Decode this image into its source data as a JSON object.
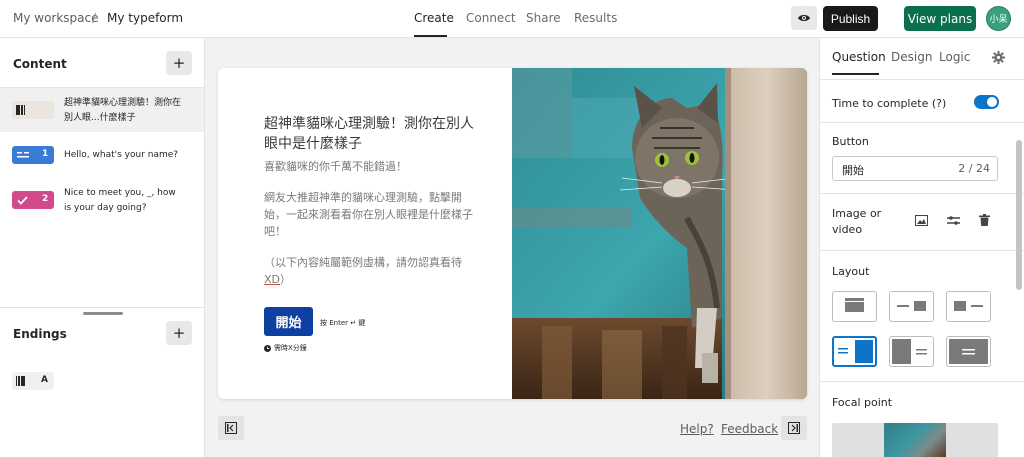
{
  "header": {
    "workspace": "My workspace",
    "separator": "/",
    "form_name": "My typeform",
    "tabs": [
      {
        "label": "Create"
      },
      {
        "label": "Connect"
      },
      {
        "label": "Share"
      },
      {
        "label": "Results"
      }
    ],
    "publish_label": "Publish",
    "plans_label": "View plans",
    "avatar_text": "小呆"
  },
  "left_panel": {
    "content_title": "Content",
    "items": [
      {
        "badge": "",
        "text": "超神準貓咪心理測驗！測你在別人眼...什麼樣子"
      },
      {
        "badge": "1",
        "text": "Hello, what's your name?"
      },
      {
        "badge": "2",
        "text": "Nice to meet you, _, how is your day going?"
      }
    ],
    "endings_title": "Endings",
    "ending_badge": "A"
  },
  "card": {
    "title": "超神準貓咪心理測驗！測你在別人眼中是什麼樣子",
    "subtitle": "喜歡貓咪的你千萬不能錯過！",
    "body": "網友大推超神準的貓咪心理測驗，點擊開始，一起來測看看你在別人眼裡是什麼樣子吧！",
    "note_prefix": "（以下內容純屬範例虛構，請勿認真看待 ",
    "note_xd": "XD",
    "note_suffix": "）",
    "start_button": "開始",
    "enter_hint": "按 Enter ↵ 鍵",
    "time_hint": "需時X分鐘"
  },
  "bottom_bar": {
    "help": "Help?",
    "feedback": "Feedback"
  },
  "right_panel": {
    "tabs": [
      {
        "label": "Question"
      },
      {
        "label": "Design"
      },
      {
        "label": "Logic"
      }
    ],
    "time_to_complete": "Time to complete (?)",
    "button_label": "Button",
    "button_value": "開始",
    "button_count": "2 / 24",
    "image_or_video": "Image or video",
    "layout_title": "Layout",
    "focal_point": "Focal point"
  },
  "colors": {
    "publish_bg": "#191919",
    "plans_bg": "#0b6e4f",
    "start_button_bg": "#0e40a2",
    "toggle_on": "#0e74c7",
    "badge_short_text": "#3a7bd5",
    "badge_multiple_choice": "#d04a8c"
  }
}
